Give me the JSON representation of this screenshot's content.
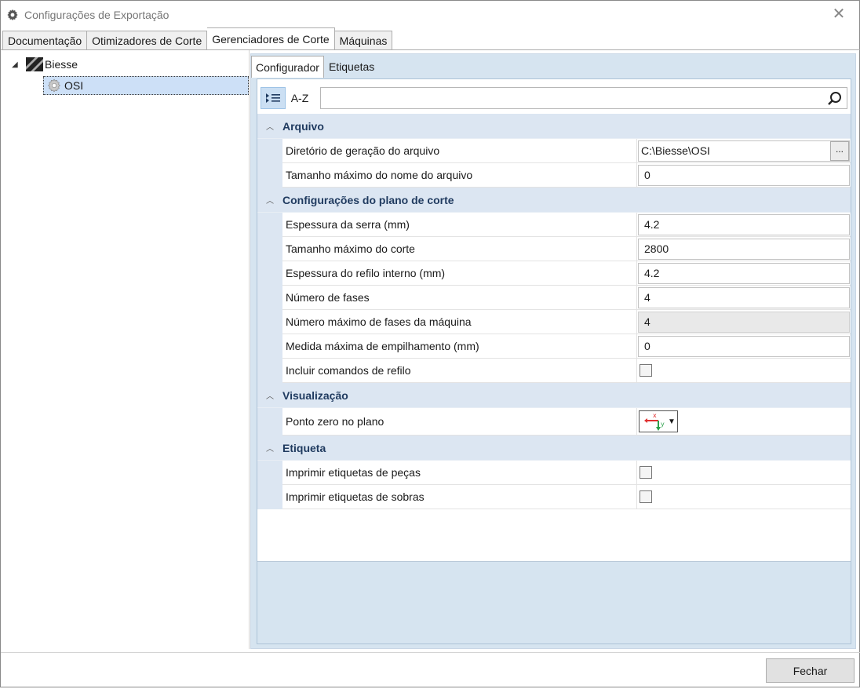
{
  "window": {
    "title": "Configurações de Exportação"
  },
  "tabs": [
    {
      "label": "Documentação",
      "active": false
    },
    {
      "label": "Otimizadores de Corte",
      "active": false
    },
    {
      "label": "Gerenciadores de Corte",
      "active": true
    },
    {
      "label": "Máquinas",
      "active": false
    }
  ],
  "tree": {
    "root": {
      "label": "Biesse",
      "icon": "biesse-logo-icon",
      "expanded": true
    },
    "child": {
      "label": "OSI",
      "icon": "gear-icon",
      "selected": true
    }
  },
  "subtabs": [
    {
      "label": "Configurador",
      "active": true
    },
    {
      "label": "Etiquetas",
      "active": false
    }
  ],
  "toolbar": {
    "categorized_icon": "categorized-list-icon",
    "alpha_label": "A-Z",
    "search_placeholder": "",
    "search_icon": "search-icon"
  },
  "grid": {
    "categories": [
      {
        "label": "Arquivo",
        "properties": [
          {
            "name": "Diretório de geração do arquivo",
            "value": "C:\\Biesse\\OSI",
            "type": "path",
            "button": "..."
          },
          {
            "name": "Tamanho máximo do nome do arquivo",
            "value": "0",
            "type": "text"
          }
        ]
      },
      {
        "label": "Configurações do plano de corte",
        "properties": [
          {
            "name": "Espessura da serra (mm)",
            "value": "4.2",
            "type": "text"
          },
          {
            "name": "Tamanho máximo do corte",
            "value": "2800",
            "type": "text"
          },
          {
            "name": "Espessura do refilo interno (mm)",
            "value": "4.2",
            "type": "text"
          },
          {
            "name": "Número de fases",
            "value": "4",
            "type": "text"
          },
          {
            "name": "Número máximo de fases da máquina",
            "value": "4",
            "type": "readonly"
          },
          {
            "name": "Medida máxima de empilhamento (mm)",
            "value": "0",
            "type": "text"
          },
          {
            "name": "Incluir comandos de refilo",
            "value": false,
            "type": "checkbox"
          }
        ]
      },
      {
        "label": "Visualização",
        "properties": [
          {
            "name": "Ponto zero no plano",
            "value": "origin-top-left",
            "type": "origin"
          }
        ]
      },
      {
        "label": "Etiqueta",
        "properties": [
          {
            "name": "Imprimir etiquetas de peças",
            "value": false,
            "type": "checkbox"
          },
          {
            "name": "Imprimir etiquetas de sobras",
            "value": false,
            "type": "checkbox"
          }
        ]
      }
    ]
  },
  "origin_axis": {
    "x": "x",
    "y": "y"
  },
  "footer": {
    "close_label": "Fechar"
  },
  "colors": {
    "accent": "#cde0f7",
    "category_bg": "#dce6f2",
    "pane_bg": "#d6e4f0",
    "axis_x": "#e03030",
    "axis_y": "#2aa04a"
  }
}
